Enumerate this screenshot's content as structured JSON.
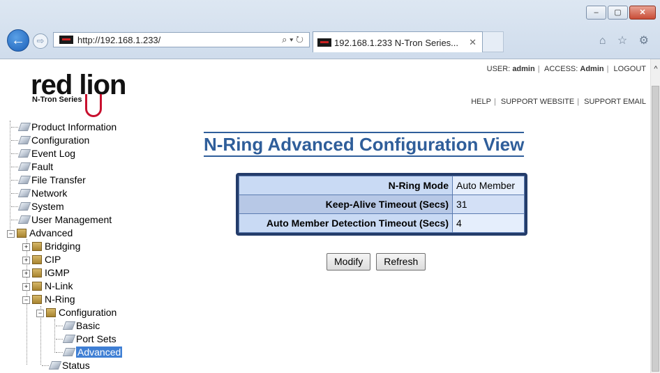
{
  "browser": {
    "address": "http://192.168.1.233/",
    "tab_title": "192.168.1.233 N-Tron Series...",
    "addr_tools": "⌕ ▾ ↻",
    "tab_close": "✕",
    "window_buttons": [
      "–",
      "▢",
      "✕"
    ],
    "right_icons": "⌂ ☆ ⚙"
  },
  "header": {
    "logo_text": "red lion",
    "logo_sub": "N-Tron Series",
    "user_label": "USER:",
    "user": "admin",
    "access_label": "ACCESS:",
    "access": "Admin",
    "logout": "LOGOUT",
    "help": "HELP",
    "support_website": "SUPPORT WEBSITE",
    "support_email": "SUPPORT EMAIL"
  },
  "tree": {
    "product_information": "Product Information",
    "configuration": "Configuration",
    "event_log": "Event Log",
    "fault": "Fault",
    "file_transfer": "File Transfer",
    "network": "Network",
    "system": "System",
    "user_management": "User Management",
    "advanced": "Advanced",
    "bridging": "Bridging",
    "cip": "CIP",
    "igmp": "IGMP",
    "nlink": "N-Link",
    "nring": "N-Ring",
    "nring_configuration": "Configuration",
    "basic": "Basic",
    "port_sets": "Port Sets",
    "advanced_selected": "Advanced",
    "status": "Status"
  },
  "main": {
    "title": "N-Ring Advanced Configuration View",
    "rows": [
      {
        "label": "N-Ring Mode",
        "value": "Auto Member"
      },
      {
        "label": "Keep-Alive Timeout (Secs)",
        "value": "31"
      },
      {
        "label": "Auto Member Detection Timeout (Secs)",
        "value": "4"
      }
    ],
    "modify_button": "Modify",
    "refresh_button": "Refresh"
  }
}
